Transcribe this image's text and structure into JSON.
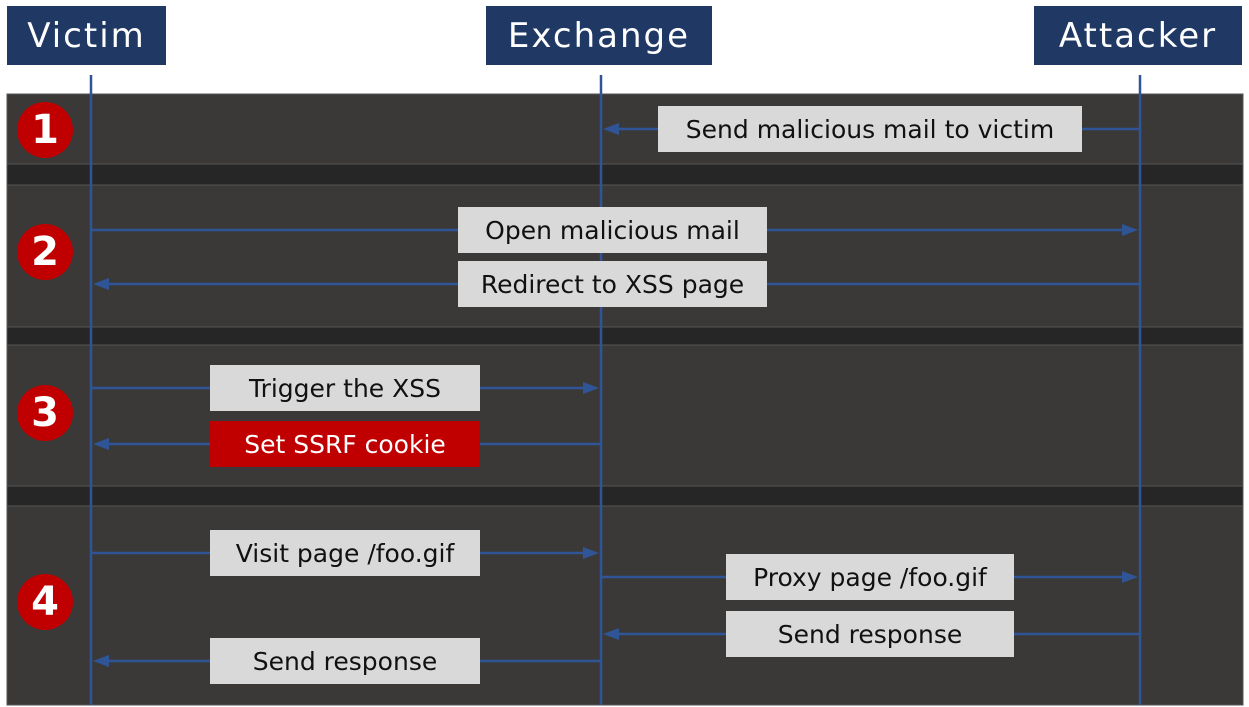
{
  "participants": [
    {
      "name": "Victim"
    },
    {
      "name": "Exchange"
    },
    {
      "name": "Attacker"
    }
  ],
  "steps": [
    "1",
    "2",
    "3",
    "4"
  ],
  "messages": [
    {
      "step": 1,
      "from": "Attacker",
      "to": "Exchange",
      "label": "Send malicious mail to victim",
      "highlight": false
    },
    {
      "step": 2,
      "from": "Victim",
      "to": "Attacker",
      "label": "Open malicious mail",
      "highlight": false
    },
    {
      "step": 2,
      "from": "Attacker",
      "to": "Victim",
      "label": "Redirect to XSS page",
      "highlight": false
    },
    {
      "step": 3,
      "from": "Victim",
      "to": "Exchange",
      "label": "Trigger the XSS",
      "highlight": false
    },
    {
      "step": 3,
      "from": "Exchange",
      "to": "Victim",
      "label": "Set SSRF cookie",
      "highlight": true
    },
    {
      "step": 4,
      "from": "Victim",
      "to": "Exchange",
      "label": "Visit page /foo.gif",
      "highlight": false
    },
    {
      "step": 4,
      "from": "Exchange",
      "to": "Attacker",
      "label": "Proxy page /foo.gif",
      "highlight": false
    },
    {
      "step": 4,
      "from": "Attacker",
      "to": "Exchange",
      "label": "Send response",
      "highlight": false
    },
    {
      "step": 4,
      "from": "Exchange",
      "to": "Victim",
      "label": "Send response",
      "highlight": false
    }
  ],
  "colors": {
    "header": "#1f3864",
    "lifeline": "#2f5597",
    "panel": "#3a3938",
    "separator": "#262626",
    "step_badge": "#c00000",
    "highlight": "#c00000",
    "label_bg": "#d9d9d9"
  }
}
